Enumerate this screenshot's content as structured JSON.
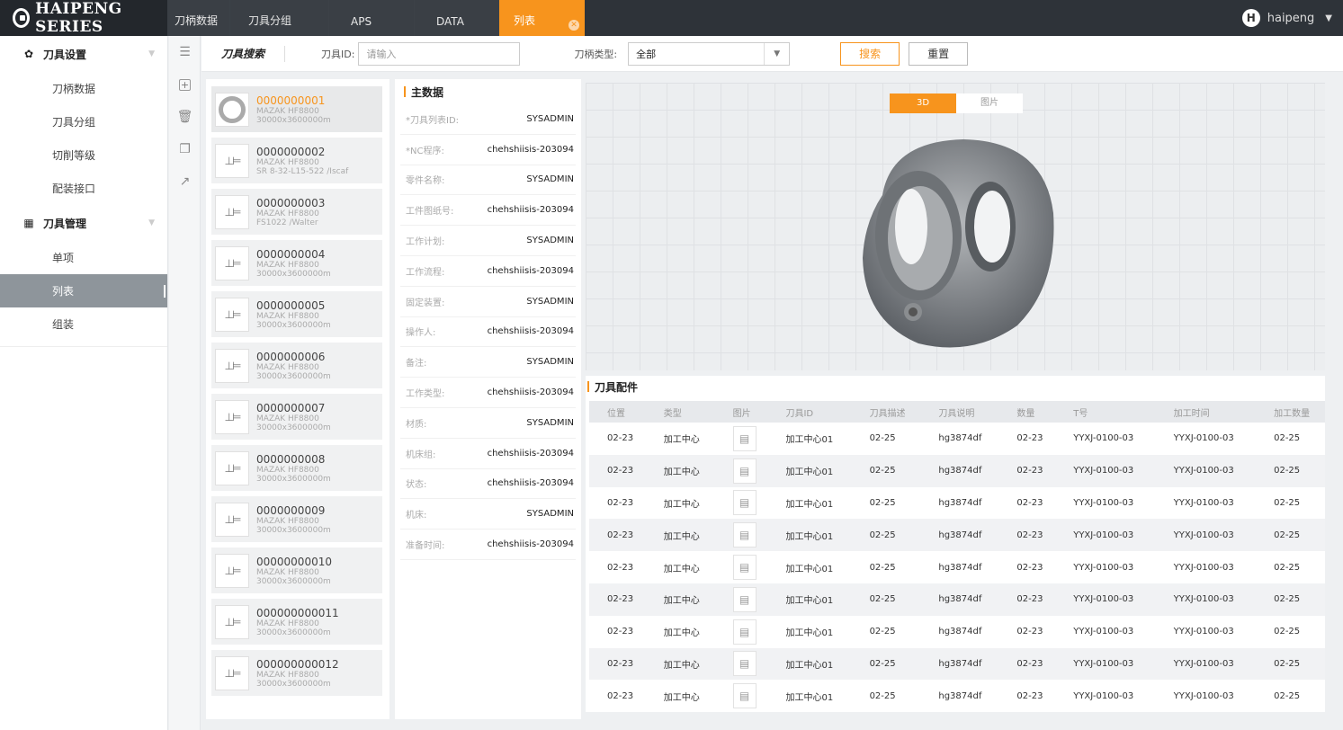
{
  "app": {
    "logo_text": "HAIPENG SERIES"
  },
  "tabs": [
    {
      "label": "刀柄数据"
    },
    {
      "label": "刀具分组"
    },
    {
      "label": "APS"
    },
    {
      "label": "DATA"
    },
    {
      "label": "列表"
    }
  ],
  "user": {
    "initial": "H",
    "name": "haipeng"
  },
  "sidebar": {
    "groups": [
      {
        "label": "刀具设置",
        "items": [
          "刀柄数据",
          "刀具分组",
          "切削等级",
          "配装接口"
        ]
      },
      {
        "label": "刀具管理",
        "items": [
          "单项",
          "列表",
          "组装"
        ]
      }
    ]
  },
  "search": {
    "title": "刀具搜索",
    "id_label": "刀具ID:",
    "id_placeholder": "请输入",
    "type_label": "刀柄类型:",
    "type_value": "全部",
    "search_button": "搜索",
    "reset_button": "重置"
  },
  "list": [
    {
      "id": "0000000001",
      "line1": "MAZAK HF8800",
      "line2": "30000x3600000m"
    },
    {
      "id": "0000000002",
      "line1": "MAZAK HF8800",
      "line2": "SR 8-32-L15-522 /Iscaf"
    },
    {
      "id": "0000000003",
      "line1": "MAZAK HF8800",
      "line2": "FS1022 /Walter"
    },
    {
      "id": "0000000004",
      "line1": "MAZAK HF8800",
      "line2": "30000x3600000m"
    },
    {
      "id": "0000000005",
      "line1": "MAZAK HF8800",
      "line2": "30000x3600000m"
    },
    {
      "id": "0000000006",
      "line1": "MAZAK HF8800",
      "line2": "30000x3600000m"
    },
    {
      "id": "0000000007",
      "line1": "MAZAK HF8800",
      "line2": "30000x3600000m"
    },
    {
      "id": "0000000008",
      "line1": "MAZAK HF8800",
      "line2": "30000x3600000m"
    },
    {
      "id": "0000000009",
      "line1": "MAZAK HF8800",
      "line2": "30000x3600000m"
    },
    {
      "id": "00000000010",
      "line1": "MAZAK HF8800",
      "line2": "30000x3600000m"
    },
    {
      "id": "000000000011",
      "line1": "MAZAK HF8800",
      "line2": "30000x3600000m"
    },
    {
      "id": "000000000012",
      "line1": "MAZAK HF8800",
      "line2": "30000x3600000m"
    }
  ],
  "main_data": {
    "title": "主数据",
    "fields": [
      {
        "k": "*刀具列表ID:",
        "v": "SYSADMIN"
      },
      {
        "k": "*NC程序:",
        "v": "chehshiisis-203094"
      },
      {
        "k": "零件名称:",
        "v": "SYSADMIN"
      },
      {
        "k": "工件图纸号:",
        "v": "chehshiisis-203094"
      },
      {
        "k": "工作计划:",
        "v": "SYSADMIN"
      },
      {
        "k": "工作流程:",
        "v": "chehshiisis-203094"
      },
      {
        "k": "固定装置:",
        "v": "SYSADMIN"
      },
      {
        "k": "操作人:",
        "v": "chehshiisis-203094"
      },
      {
        "k": "备注:",
        "v": "SYSADMIN"
      },
      {
        "k": "工作类型:",
        "v": "chehshiisis-203094"
      },
      {
        "k": "材质:",
        "v": "SYSADMIN"
      },
      {
        "k": "机床组:",
        "v": "chehshiisis-203094"
      },
      {
        "k": "状态:",
        "v": "chehshiisis-203094"
      },
      {
        "k": "机床:",
        "v": "SYSADMIN"
      },
      {
        "k": "准备时间:",
        "v": "chehshiisis-203094"
      }
    ]
  },
  "viewer": {
    "tab_3d": "3D",
    "tab_image": "图片"
  },
  "accessories": {
    "title": "刀具配件",
    "columns": [
      "位置",
      "类型",
      "图片",
      "刀具ID",
      "刀具描述",
      "刀具说明",
      "数量",
      "T号",
      "加工时间",
      "加工数量"
    ],
    "rows": [
      [
        "02-23",
        "加工中心",
        "",
        "加工中心01",
        "02-25",
        "hg3874df",
        "02-23",
        "YYXJ-0100-03",
        "YYXJ-0100-03",
        "02-25"
      ],
      [
        "02-23",
        "加工中心",
        "",
        "加工中心01",
        "02-25",
        "hg3874df",
        "02-23",
        "YYXJ-0100-03",
        "YYXJ-0100-03",
        "02-25"
      ],
      [
        "02-23",
        "加工中心",
        "",
        "加工中心01",
        "02-25",
        "hg3874df",
        "02-23",
        "YYXJ-0100-03",
        "YYXJ-0100-03",
        "02-25"
      ],
      [
        "02-23",
        "加工中心",
        "",
        "加工中心01",
        "02-25",
        "hg3874df",
        "02-23",
        "YYXJ-0100-03",
        "YYXJ-0100-03",
        "02-25"
      ],
      [
        "02-23",
        "加工中心",
        "",
        "加工中心01",
        "02-25",
        "hg3874df",
        "02-23",
        "YYXJ-0100-03",
        "YYXJ-0100-03",
        "02-25"
      ],
      [
        "02-23",
        "加工中心",
        "",
        "加工中心01",
        "02-25",
        "hg3874df",
        "02-23",
        "YYXJ-0100-03",
        "YYXJ-0100-03",
        "02-25"
      ],
      [
        "02-23",
        "加工中心",
        "",
        "加工中心01",
        "02-25",
        "hg3874df",
        "02-23",
        "YYXJ-0100-03",
        "YYXJ-0100-03",
        "02-25"
      ],
      [
        "02-23",
        "加工中心",
        "",
        "加工中心01",
        "02-25",
        "hg3874df",
        "02-23",
        "YYXJ-0100-03",
        "YYXJ-0100-03",
        "02-25"
      ],
      [
        "02-23",
        "加工中心",
        "",
        "加工中心01",
        "02-25",
        "hg3874df",
        "02-23",
        "YYXJ-0100-03",
        "YYXJ-0100-03",
        "02-25"
      ]
    ]
  },
  "colors": {
    "accent": "#f7941d",
    "topbar": "#2e3339",
    "sidebar_active": "#8e959b"
  }
}
